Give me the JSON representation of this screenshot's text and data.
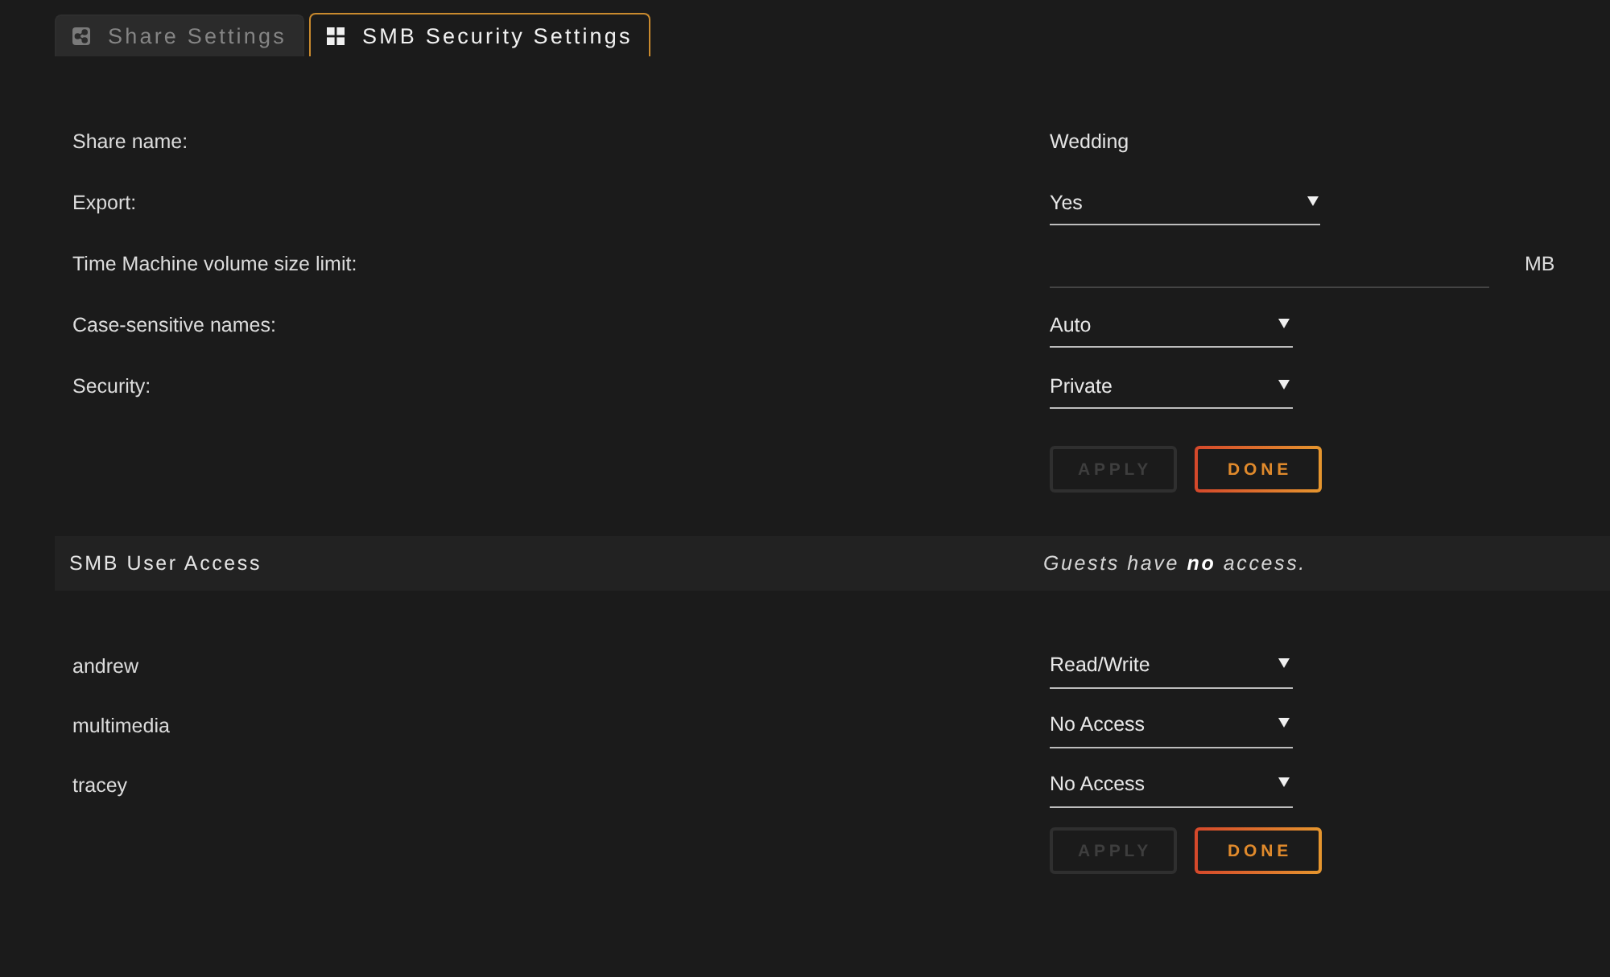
{
  "tabs": [
    {
      "label": "Share Settings",
      "selected": false
    },
    {
      "label": "SMB Security Settings",
      "selected": true
    }
  ],
  "settings": {
    "rows": [
      {
        "kind": "text",
        "label": "Share name:",
        "value": "Wedding"
      },
      {
        "kind": "select",
        "label": "Export:",
        "value": "Yes"
      },
      {
        "kind": "input",
        "label": "Time Machine volume size limit:",
        "unit": "MB"
      },
      {
        "kind": "select",
        "label": "Case-sensitive names:",
        "value": "Auto"
      },
      {
        "kind": "select",
        "label": "Security:",
        "value": "Private"
      }
    ],
    "buttons": [
      {
        "label": "APPLY",
        "disabled": true
      },
      {
        "label": "DONE",
        "disabled": false
      }
    ]
  },
  "user_access": {
    "title": "SMB User Access",
    "note": "Guests have **no** access.",
    "users": [
      {
        "name": "andrew",
        "access": "Read/Write"
      },
      {
        "name": "multimedia",
        "access": "No Access"
      },
      {
        "name": "tracey",
        "access": "No Access"
      }
    ],
    "buttons": [
      {
        "label": "APPLY",
        "disabled": true
      },
      {
        "label": "DONE",
        "disabled": false
      }
    ]
  }
}
